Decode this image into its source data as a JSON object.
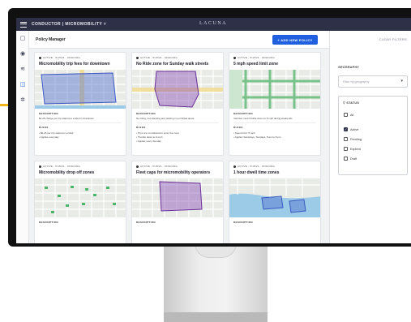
{
  "app": {
    "title": "CONDUCTOR | MICROMOBILITY ˅",
    "logo": "LACUNA"
  },
  "toolbar": {
    "page_title": "Policy Manager",
    "add_button": "+ ADD NEW POLICY"
  },
  "rail": {
    "icons": [
      "map-icon",
      "pin-icon",
      "chart-icon",
      "policy-icon",
      "settings-icon"
    ]
  },
  "filters": {
    "clear": "CLEAR FILTERS",
    "geography_label": "GEOGRAPHY",
    "geography_placeholder": "Filter by geography",
    "status_label": "STATUS",
    "statuses": [
      {
        "label": "All",
        "checked": false
      },
      {
        "label": "Active",
        "checked": true
      },
      {
        "label": "Pending",
        "checked": false
      },
      {
        "label": "Expired",
        "checked": false
      },
      {
        "label": "Draft",
        "checked": false
      }
    ]
  },
  "cards": [
    {
      "meta": "ACTIVE · 5/15/21 - ONGOING",
      "title": "Micromobility trip fees for downtown",
      "map_color": "#4f6ecf",
      "description_label": "DESCRIPTION",
      "description": "$0.25 charge per trip started or ended in downtown",
      "rules_label": "RULES",
      "rules": [
        "• $0.25 per trip started or ended",
        "• Applies everyday"
      ]
    },
    {
      "meta": "ACTIVE · 5/15/21 - ONGOING",
      "title": "No Ride zone for Sunday walk streets",
      "map_color": "#8a4fb5",
      "description_label": "DESCRIPTION",
      "description": "No riding, but standing and parking in permitted areas",
      "rules_label": "RULES",
      "rules": [
        "• Trips are not allowed to enter the zone",
        "• Throttle down to 0 mph",
        "• Applies every Sunday"
      ]
    },
    {
      "meta": "ACTIVE · 5/15/21 - ONGOING",
      "title": "5 mph speed limit zone",
      "map_color": "#4fb56a",
      "description_label": "DESCRIPTION",
      "description": "Vehicles must throttle down to 5 mph during weekends",
      "rules_label": "RULES",
      "rules": [
        "• Speed limit: 5 mph",
        "• Applies Saturdays, Sundays, 8 am to 8 pm"
      ]
    },
    {
      "meta": "ACTIVE · 5/15/21 - ONGOING",
      "title": "Micromobility drop off zones",
      "map_color": "#4fb56a",
      "description_label": "DESCRIPTION",
      "description": "",
      "rules_label": "",
      "rules": []
    },
    {
      "meta": "ACTIVE · 5/15/21 - ONGOING",
      "title": "Fleet caps for micromobility operators",
      "map_color": "#8a4fb5",
      "description_label": "DESCRIPTION",
      "description": "",
      "rules_label": "",
      "rules": []
    },
    {
      "meta": "ACTIVE · 5/15/21 - ONGOING",
      "title": "1 hour dwell time zones",
      "map_color": "#4f6ecf",
      "description_label": "DESCRIPTION",
      "description": "",
      "rules_label": "",
      "rules": []
    }
  ]
}
